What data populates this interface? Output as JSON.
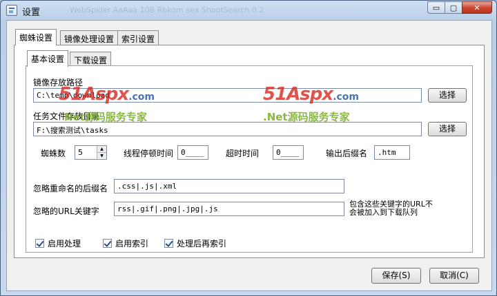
{
  "window": {
    "title": "设置",
    "ghost_title": "WebSpider AaAaa 10B Rbkom sea  ShootSearch 0.2"
  },
  "window_buttons": {
    "minimize": "▭",
    "maximize": "▢",
    "close": "✕"
  },
  "tabs": [
    "蜘蛛设置",
    "镜像处理设置",
    "索引设置"
  ],
  "subtabs": [
    "基本设置",
    "下载设置"
  ],
  "form": {
    "mirror_path": {
      "label": "镜像存放路径",
      "value": "C:\\temp\\download",
      "button": "选择"
    },
    "task_dir": {
      "label": "任务文件存放目录",
      "value": "F:\\搜索测试\\tasks",
      "button": "选择"
    },
    "spider_count": {
      "label": "蜘蛛数",
      "value": "5"
    },
    "thread_pause": {
      "label": "线程停顿时间",
      "value": "0____"
    },
    "timeout": {
      "label": "超时时间",
      "value": "0____"
    },
    "output_ext": {
      "label": "输出后缀名",
      "value": ".htm"
    },
    "ignore_ext": {
      "label": "忽略重命名的后缀名",
      "value": ".css|.js|.xml"
    },
    "ignore_url": {
      "label": "忽略的URL关键字",
      "value": "rss|.gif|.png|.jpg|.js",
      "hint_line1": "包含这些关键字的URL不",
      "hint_line2": "会被加入到下载队列"
    },
    "checkboxes": [
      {
        "label": "启用处理",
        "checked": true
      },
      {
        "label": "启用索引",
        "checked": true
      },
      {
        "label": "处理后再索引",
        "checked": true
      }
    ]
  },
  "buttons": {
    "save": "保存(S)",
    "cancel": "取消(C)"
  },
  "watermark": {
    "logo_a": "51",
    "logo_b": "Aspx",
    "logo_domain": ".com",
    "tagline_1": "Net源码服务专家",
    "tagline_2": ".Net源码服务专家"
  }
}
